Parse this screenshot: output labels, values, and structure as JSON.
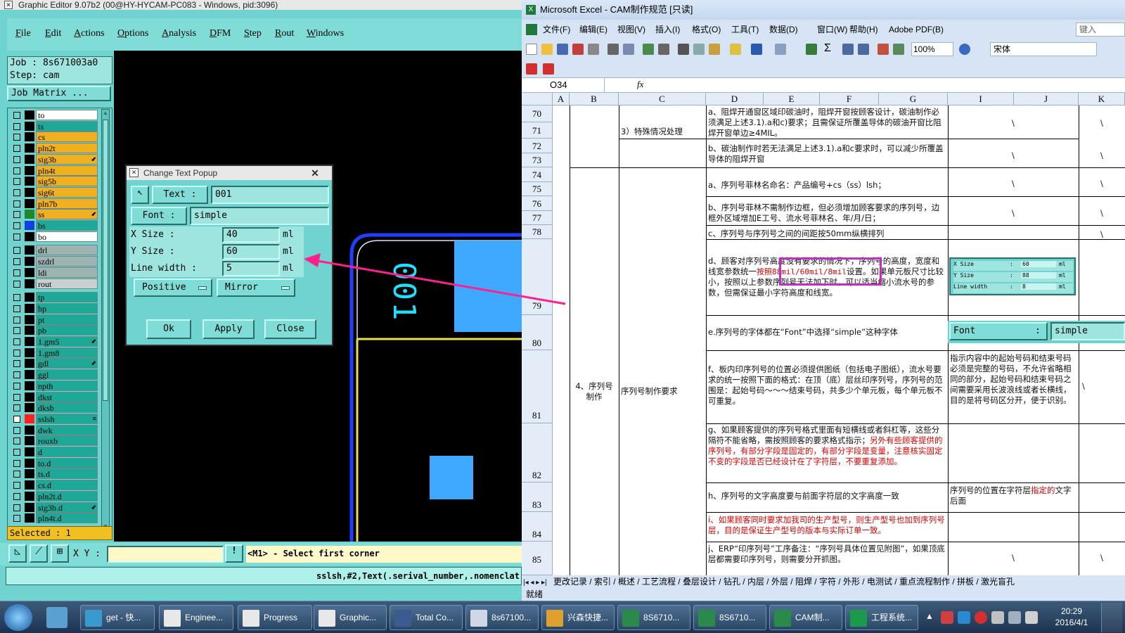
{
  "genesis": {
    "title": "Graphic Editor 9.07b2 (00@HY-HYCAM-PC083 - Windows, pid:3096)",
    "menu": [
      "File",
      "Edit",
      "Actions",
      "Options",
      "Analysis",
      "DFM",
      "Step",
      "Rout",
      "Windows"
    ],
    "job_label": "Job  : 8s671003a0",
    "step_label": "Step: cam",
    "job_matrix": "Job Matrix ...",
    "selected": "Selected : 1",
    "xy_label": "X Y :",
    "prompt": "<M1> - Select first corner",
    "cmd_line": "sslsh,#2,Text(.serival_number,.nomenclat",
    "layers": [
      {
        "name": "to",
        "color": "#ffffff",
        "swatch": "#000000"
      },
      {
        "name": "ts",
        "color": "#1ea898",
        "swatch": "#000000"
      },
      {
        "name": "cs",
        "color": "#f0b020",
        "swatch": "#000000"
      },
      {
        "name": "pln2t",
        "color": "#f0b020",
        "swatch": "#000000"
      },
      {
        "name": "sig3b",
        "color": "#f0b020",
        "swatch": "#000000",
        "mark": "⬋"
      },
      {
        "name": "pln4t",
        "color": "#f0b020",
        "swatch": "#000000"
      },
      {
        "name": "sig5b",
        "color": "#f0b020",
        "swatch": "#000000"
      },
      {
        "name": "sig6t",
        "color": "#f0b020",
        "swatch": "#000000"
      },
      {
        "name": "pln7b",
        "color": "#f0b020",
        "swatch": "#000000"
      },
      {
        "name": "ss",
        "color": "#f0b020",
        "swatch": "#1a8a2a",
        "mark": "⬋"
      },
      {
        "name": "bs",
        "color": "#1ea898",
        "swatch": "#1040e0"
      },
      {
        "name": "bo",
        "color": "#ffffff",
        "swatch": "#000000"
      },
      {
        "name": "drl",
        "color": "#9fb3b3",
        "swatch": "#000000"
      },
      {
        "name": "szdrl",
        "color": "#9fb3b3",
        "swatch": "#000000"
      },
      {
        "name": "ldi",
        "color": "#9fb3b3",
        "swatch": "#000000"
      },
      {
        "name": "rout",
        "color": "#c8d0d0",
        "swatch": "#000000"
      },
      {
        "name": "tp",
        "color": "#1ea898",
        "swatch": "#000000"
      },
      {
        "name": "bp",
        "color": "#1ea898",
        "swatch": "#000000"
      },
      {
        "name": "pt",
        "color": "#1ea898",
        "swatch": "#000000"
      },
      {
        "name": "pb",
        "color": "#1ea898",
        "swatch": "#000000"
      },
      {
        "name": "1.gm5",
        "color": "#1ea898",
        "swatch": "#000000",
        "mark": "⬋"
      },
      {
        "name": "1.gm8",
        "color": "#1ea898",
        "swatch": "#000000"
      },
      {
        "name": "gdl",
        "color": "#1ea898",
        "swatch": "#000000",
        "mark": "⬋"
      },
      {
        "name": "ggl",
        "color": "#1ea898",
        "swatch": "#000000"
      },
      {
        "name": "npth",
        "color": "#1ea898",
        "swatch": "#000000"
      },
      {
        "name": "dkst",
        "color": "#1ea898",
        "swatch": "#000000"
      },
      {
        "name": "dksb",
        "color": "#1ea898",
        "swatch": "#000000"
      },
      {
        "name": "sslsh",
        "color": "#1ea898",
        "swatch": "#ff2020",
        "mark": "≡",
        "active": true
      },
      {
        "name": "dwk",
        "color": "#1ea898",
        "swatch": "#000000"
      },
      {
        "name": "rouxb",
        "color": "#1ea898",
        "swatch": "#000000"
      },
      {
        "name": "d",
        "color": "#1ea898",
        "swatch": "#000000"
      },
      {
        "name": "to.d",
        "color": "#1ea898",
        "swatch": "#000000"
      },
      {
        "name": "ts.d",
        "color": "#1ea898",
        "swatch": "#000000"
      },
      {
        "name": "cs.d",
        "color": "#1ea898",
        "swatch": "#000000"
      },
      {
        "name": "pln2t.d",
        "color": "#1ea898",
        "swatch": "#000000"
      },
      {
        "name": "sig3b.d",
        "color": "#1ea898",
        "swatch": "#000000",
        "mark": "⬋"
      },
      {
        "name": "pln4t.d",
        "color": "#1ea898",
        "swatch": "#000000"
      }
    ],
    "canvas_text": "001"
  },
  "popup": {
    "title": "Change Text Popup",
    "text_label": "Text  :",
    "text_value": "001",
    "font_label": "Font  :",
    "font_value": "simple",
    "x_size_label": "X Size      :",
    "x_size": "40",
    "y_size_label": "Y Size      :",
    "y_size": "60",
    "line_width_label": "Line width  :",
    "line_width": "5",
    "unit": "ml",
    "positive": "Positive",
    "mirror": "Mirror",
    "ok": "Ok",
    "apply": "Apply",
    "close": "Close"
  },
  "excel": {
    "title": "Microsoft Excel - CAM制作规范 [只读]",
    "menu": [
      "文件(F)",
      "编辑(E)",
      "视图(V)",
      "插入(I)",
      "格式(O)",
      "工具(T)",
      "数据(D)",
      "窗口(W)",
      "帮助(H)",
      "Adobe PDF(B)"
    ],
    "help_box": "键入",
    "zoom": "100%",
    "font": "宋体",
    "name_box": "O34",
    "fx": "fx",
    "columns": [
      "A",
      "B",
      "C",
      "D",
      "E",
      "F",
      "G",
      "I",
      "J",
      "K"
    ],
    "rows": [
      "70",
      "71",
      "72",
      "73",
      "74",
      "75",
      "76",
      "77",
      "78",
      "79",
      "80",
      "81",
      "82",
      "83",
      "84",
      "85"
    ],
    "sec3": "3）特殊情况处理",
    "sec4": "4、序列号制作",
    "sec4_c": "序列号制作要求",
    "a1": "a、阻焊开通窗区域印碳油时，阻焊开窗按顾客设计，碳油制作必须满足上述3.1).a和c)要求；且需保证所覆盖导体的碳油开窗比阻焊开窗单边≥4MIL。",
    "b1": "b、碳油制作时若无法满足上述3.1).a和c要求时，可以减少所覆盖导体的阻焊开窗",
    "a2": "a、序列号菲林名命名：产品编号+cs（ss）lsh；",
    "b2": "b、序列号菲林不需制作边框，但必须增加顾客要求的序列号，边框外区域增加E工号、流水号菲林名、年/月/日；",
    "c2": "c、序列号与序列号之间的间距按50mm纵横排列",
    "d2_pre": "d、顾客对序列号高度没有要求的情况下，序列号的高度，宽度和线宽参数统一",
    "d2_red": "按照88mil/60mil/8mil",
    "d2_post": "设置。如果单元板尺寸比较小，按照以上参数序列号无法加下时，可以适当缩小流水号的参数，但需保证最小字符高度和线宽。",
    "e2": "e.序列号的字体都在“Font”中选择“simple”这种字体",
    "f2": "f、板内印序列号的位置必须提供图纸（包括电子图纸），流水号要求的统一按照下面的格式：在顶（底）层丝印序列号，序列号的范围是：起始号码～～～结束号码，共多少个单元板，每个单元板不可重复。",
    "f2_note": "指示内容中的起始号码和结束号码必须是完整的号码，不允许省略相同的部分，起始号码和结束号码之间需要采用长波浪线或者长横线，目的是将号码区分开，便于识别。",
    "g2_pre": "g、如果顾客提供的序列号格式里面有短横线或者斜杠等，这些分隔符不能省略，需按照顾客的要求格式指示；",
    "g2_red": "另外有些顾客提供的序列号，有部分字段是固定的，有部分字段是变量，注意核实固定不变的字段是否已经设计在了字符层，不要重复添加。",
    "h2": "h、序列号的文字高度要与前面字符层的文字高度一致",
    "h2_note_pre": "序列号的位置在字符层",
    "h2_note_red": "指定的",
    "h2_note_post": "文字后面",
    "i2": "i、如果顾客同时要求加我司的生产型号，则生产型号也加到序列号层，目的是保证生产型号的版本与实际订单一致。",
    "j2": "j、ERP“印序列号”工序备注：“序列号具体位置见附图”，如果顶底层都需要印序列号，则需要分开抓图。",
    "backslash": "\\",
    "mini_popup": {
      "x_label": "X Size",
      "x_val": "60",
      "y_label": "Y Size",
      "y_val": "88",
      "lw_label": "Line width",
      "lw_val": "8",
      "unit": "ml",
      "colon": ":"
    },
    "font_popup": {
      "label": "Font",
      "colon": ":",
      "value": "simple"
    },
    "tabs": "更改记录 / 索引 / 概述 / 工艺流程 / 叠层设计 / 钻孔 / 内层 / 外层 / 阻焊 / 字符 / 外形 / 电测试 / 重点流程制作 / 拼板 / 激光盲孔",
    "status": "就绪"
  },
  "taskbar": {
    "items": [
      "get - 快...",
      "Enginee...",
      "Progress",
      "Graphic...",
      "Total Co...",
      "8s67100...",
      "兴森快捷...",
      "8S6710...",
      "8S6710...",
      "CAM制...",
      "工程系统..."
    ],
    "time": "20:29",
    "date": "2016/4/1"
  },
  "colors": {
    "genesis_bg": "#6fd4cf",
    "arrow": "#ff2090",
    "highlight": "#c030c0",
    "cyan_text": "#1ee0ff",
    "blue_pad": "#3fa8ff"
  }
}
